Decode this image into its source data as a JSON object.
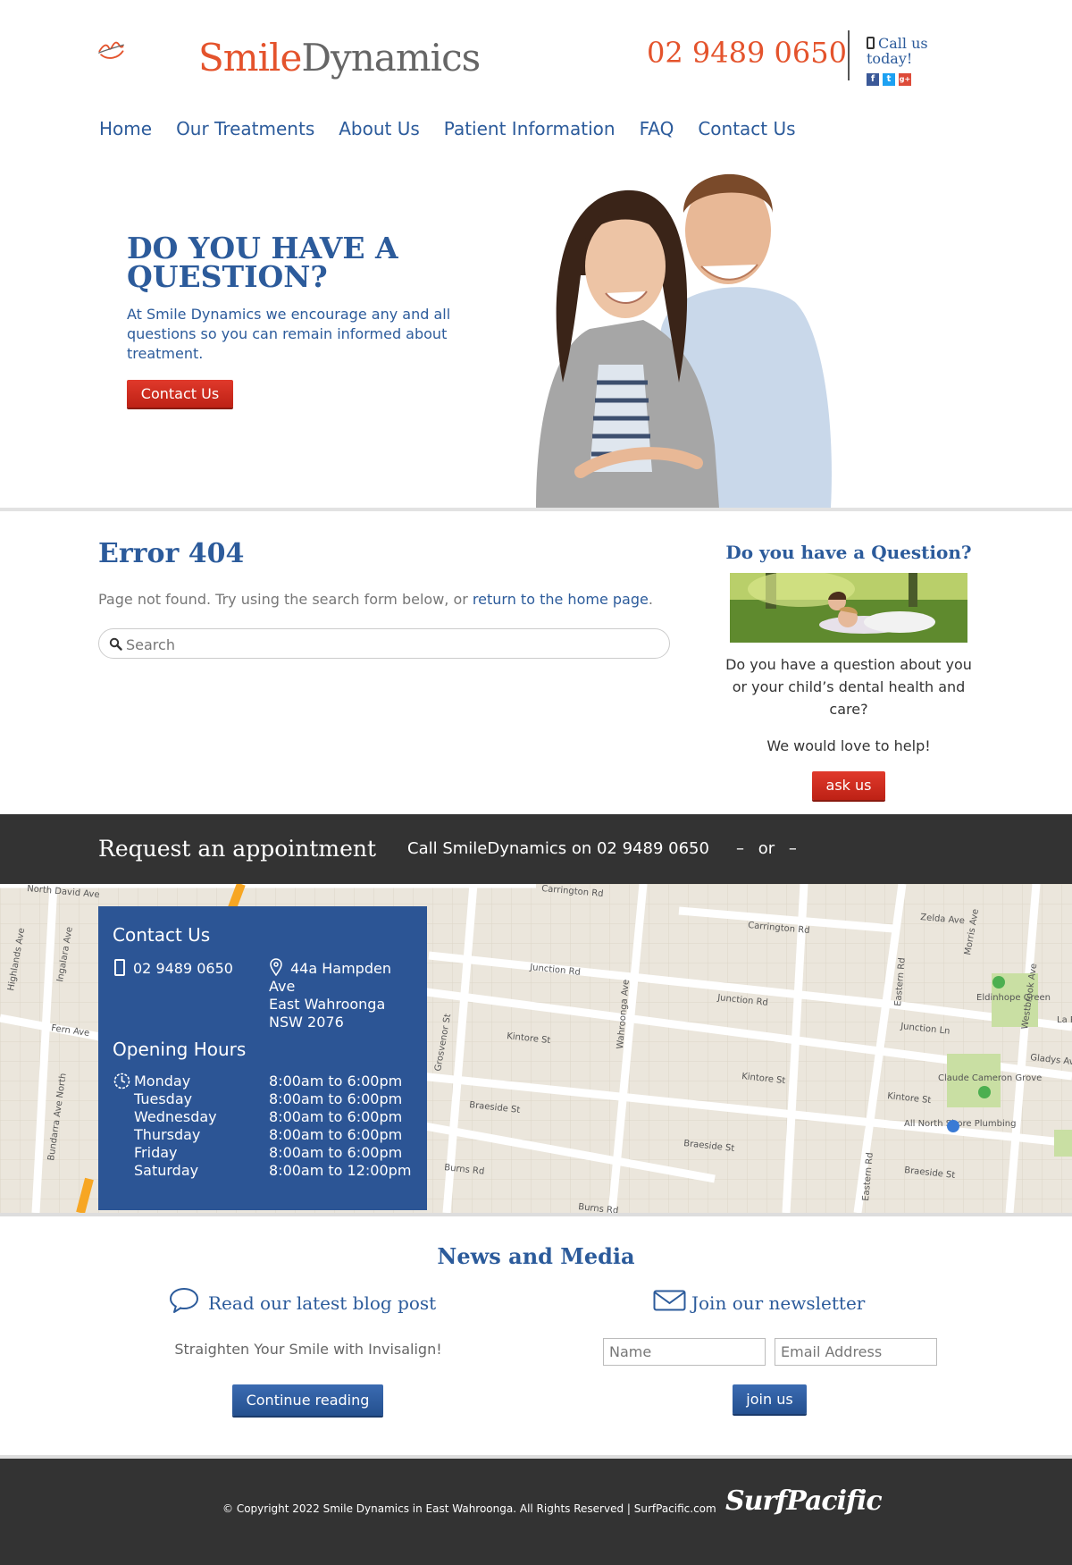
{
  "header": {
    "logo_part1": "Smile",
    "logo_part2": "Dynamics",
    "phone": "02 9489 0650",
    "call_line1": "Call us",
    "call_line2": "today!",
    "socials": [
      {
        "icon": "facebook-icon",
        "glyph": "f",
        "color": "#3b5998"
      },
      {
        "icon": "twitter-icon",
        "glyph": "t",
        "color": "#1da1f2"
      },
      {
        "icon": "google-plus-icon",
        "glyph": "g+",
        "color": "#dd4b39"
      }
    ]
  },
  "nav": [
    "Home",
    "Our Treatments",
    "About Us",
    "Patient Information",
    "FAQ",
    "Contact Us"
  ],
  "hero": {
    "title": "DO YOU HAVE A QUESTION?",
    "text": "At Smile Dynamics we encourage any and all questions so you can remain informed about treatment.",
    "button": "Contact Us"
  },
  "main": {
    "title": "Error 404",
    "text": "Page not found. Try using the search form below, or",
    "link": "return to the home page",
    "text_end": ".",
    "search_placeholder": "Search"
  },
  "sidebar": {
    "title": "Do you have a Question?",
    "text": "Do you have a question about you or your child’s dental health and care?",
    "text2": "We would love to help!",
    "button": "ask us"
  },
  "appointment": {
    "title": "Request an appointment",
    "call": "Call SmileDynamics on 02 9489 0650",
    "or": "–  or  –"
  },
  "contact_box": {
    "title": "Contact Us",
    "phone": "02 9489 0650",
    "address": [
      "44a Hampden",
      "Ave",
      "East Wahroonga",
      "NSW 2076"
    ],
    "hours_title": "Opening Hours",
    "days": [
      "Monday",
      "Tuesday",
      "Wednesday",
      "Thursday",
      "Friday",
      "Saturday"
    ],
    "times": [
      "8:00am to 6:00pm",
      "8:00am to 6:00pm",
      "8:00am to 6:00pm",
      "8:00am to 6:00pm",
      "8:00am to 6:00pm",
      "8:00am to 12:00pm"
    ]
  },
  "map": {
    "labels": [
      "North David Ave",
      "Carrington Rd",
      "Zelda Ave",
      "Morris Ave",
      "Junction Rd",
      "Junction Rd",
      "Junction Ln",
      "Eastern Rd",
      "Westbrook Ave",
      "Eldinhope Green",
      "Kintore St",
      "Kintore St",
      "Kintore St",
      "Claude Cameron Grove",
      "Gladys Av",
      "Braeside St",
      "Braeside St",
      "Braeside St",
      "All North Shore Plumbing",
      "Burns Rd",
      "Burns Rd",
      "Fern Ave",
      "Ingalara Ave",
      "Highlands Ave",
      "Bundarra Ave North",
      "Grosvenor St",
      "Wahroonga Ave",
      "Eastern Rd",
      "La Risto"
    ]
  },
  "news": {
    "title": "News and Media",
    "blog_title": "Read our latest blog post",
    "blog_post": "Straighten Your Smile with Invisalign!",
    "blog_button": "Continue reading",
    "newsletter_title": "Join our newsletter",
    "name_placeholder": "Name",
    "email_placeholder": "Email Address",
    "join_button": "join us"
  },
  "footer": {
    "copyright": "© Copyright 2022 Smile Dynamics in East Wahroonga. All Rights Reserved | SurfPacific.com",
    "brand": "SurfPacific"
  }
}
